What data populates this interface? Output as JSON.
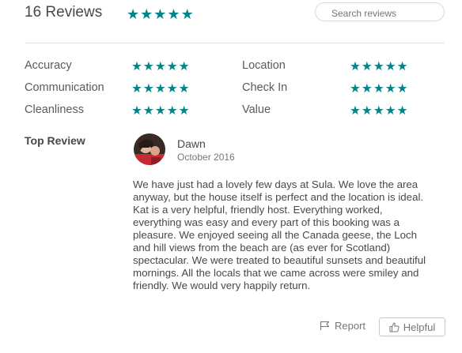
{
  "reviews": {
    "count_label": "16 Reviews",
    "overall_rating": 5,
    "search_placeholder": "Search reviews"
  },
  "categories": [
    {
      "label": "Accuracy",
      "rating": 5
    },
    {
      "label": "Location",
      "rating": 5
    },
    {
      "label": "Communication",
      "rating": 5
    },
    {
      "label": "Check In",
      "rating": 5
    },
    {
      "label": "Cleanliness",
      "rating": 5
    },
    {
      "label": "Value",
      "rating": 5
    }
  ],
  "top_review": {
    "section_label": "Top Review",
    "reviewer_name": "Dawn",
    "date": "October 2016",
    "lines": [
      "We have just had a lovely few days at Sula. We love the area",
      "anyway, but the house itself is perfect and the location is ideal.",
      "Kat is a very helpful, friendly host. Everything worked,",
      "everything was easy and every part of this booking was a",
      "pleasure. We enjoyed seeing all the Canada geese, the Loch",
      "and hill views from the beach are (as ever for Scotland)",
      "spectacular. We were treated to beautiful sunsets and beautiful",
      "mornings. All the locals that we came across were smiley and",
      "friendly. We would very happily return."
    ],
    "report_label": "Report",
    "helpful_label": "Helpful"
  },
  "icons": {
    "star": "star-icon",
    "flag": "flag-icon",
    "thumbs_up": "thumbs-up-icon"
  },
  "colors": {
    "star": "#008489",
    "text": "#484848",
    "muted": "#767676"
  }
}
